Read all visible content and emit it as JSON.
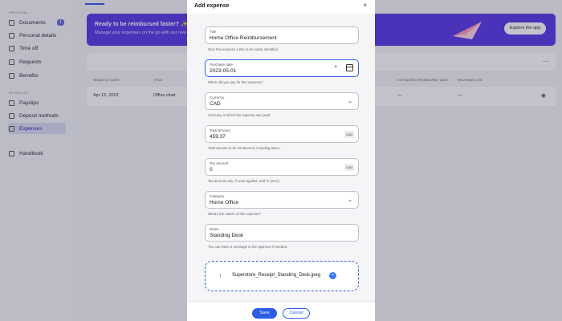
{
  "sidebar": {
    "section_personal": "PERSONAL",
    "section_payments": "PAYMENTS",
    "items": [
      {
        "label": "Documents",
        "badge": "1"
      },
      {
        "label": "Personal details"
      },
      {
        "label": "Time off"
      },
      {
        "label": "Requests"
      },
      {
        "label": "Benefits"
      },
      {
        "label": "Payslips"
      },
      {
        "label": "Deposit methods"
      },
      {
        "label": "Expenses"
      },
      {
        "label": "Handbook"
      }
    ]
  },
  "promo": {
    "title": "Ready to be reimbursed faster? ✨",
    "subtitle": "Manage your expenses on the go with our new",
    "button": "Explore the app"
  },
  "table": {
    "headers": [
      "REQUEST DATE",
      "TITLE",
      "ESTIMATED REIMBURSE DATE",
      "REVIEWED ON"
    ],
    "row": {
      "date": "Apr 13, 2023",
      "title": "Office chair",
      "est": "—",
      "reviewed": "—"
    }
  },
  "modal": {
    "title": "Add expense",
    "close_glyph": "×",
    "fields": {
      "title": {
        "label": "Title",
        "value": "Home Office Reimbursement",
        "helper": "Give this expense a title to be easily identified."
      },
      "purchase_date": {
        "label": "Purchase date",
        "value": "2023-05-01",
        "helper": "When did you pay for this expense?"
      },
      "currency": {
        "label": "Currency",
        "value": "CAD",
        "helper": "Currency in which the expense was paid."
      },
      "total": {
        "label": "Total amount",
        "value": "459.37",
        "suffix": "CAD",
        "helper": "Total amount to be reimbursed, including taxes."
      },
      "tax": {
        "label": "Tax amount",
        "value": "0",
        "suffix": "CAD",
        "helper": "Tax amount only. If none applied, add '0' (zero)."
      },
      "category": {
        "label": "Category",
        "value": "Home Office",
        "helper": "What's the nature of this expense?"
      },
      "notes": {
        "label": "Notes",
        "value": "Standing Desk",
        "helper": "You can leave a message to the approver if needed."
      }
    },
    "attachment": {
      "file_name": "Superstore_Receipt_Standing_Desk.jpeg"
    },
    "save": "Save",
    "cancel": "Cancel"
  },
  "icons": {
    "upload": "↑",
    "chevron": "⌄",
    "clear": "×",
    "more": "⋯",
    "eye": "◉"
  },
  "colors": {
    "accent": "#2c5ce8",
    "promo": "#5a3ae6",
    "scrim": "rgba(34,32,62,0.27)"
  }
}
